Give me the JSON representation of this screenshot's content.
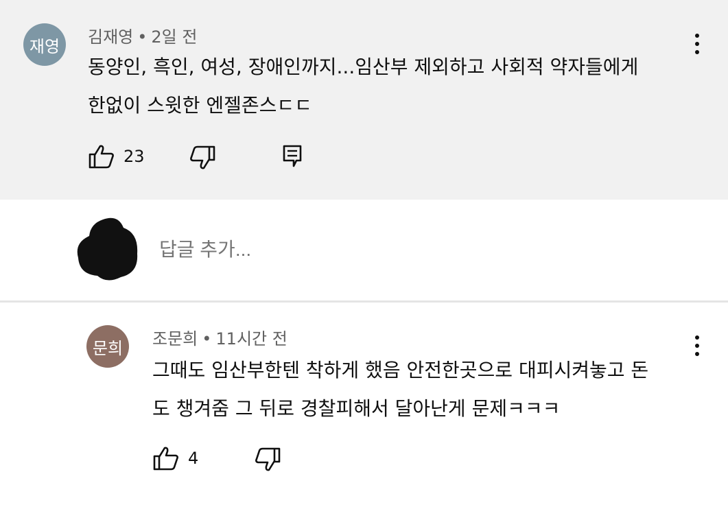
{
  "comment": {
    "avatar_text": "재영",
    "avatar_color": "#7e97a5",
    "author": "김재영",
    "separator": "•",
    "time": "2일 전",
    "text_line1": "동양인, 흑인, 여성, 장애인까지...임산부 제외하고 사회적 약자들에게",
    "text_line2": "한없이 스윗한 엔젤존스ㄷㄷ",
    "like_count": "23",
    "icons": [
      "thumbs-up-icon",
      "thumbs-down-icon",
      "reply-icon",
      "more-vert-icon"
    ]
  },
  "reply_input": {
    "placeholder": "답글 추가..."
  },
  "reply": {
    "avatar_text": "문희",
    "avatar_color": "#8d6e63",
    "author": "조문희",
    "separator": "•",
    "time": "11시간 전",
    "text_line1": "그때도 임산부한텐 착하게 했음 안전한곳으로 대피시켜놓고 돈",
    "text_line2": "도 챙겨줌 그 뒤로 경찰피해서 달아난게 문제ㅋㅋㅋ",
    "like_count": "4",
    "icons": [
      "thumbs-up-icon",
      "thumbs-down-icon",
      "more-vert-icon"
    ]
  }
}
